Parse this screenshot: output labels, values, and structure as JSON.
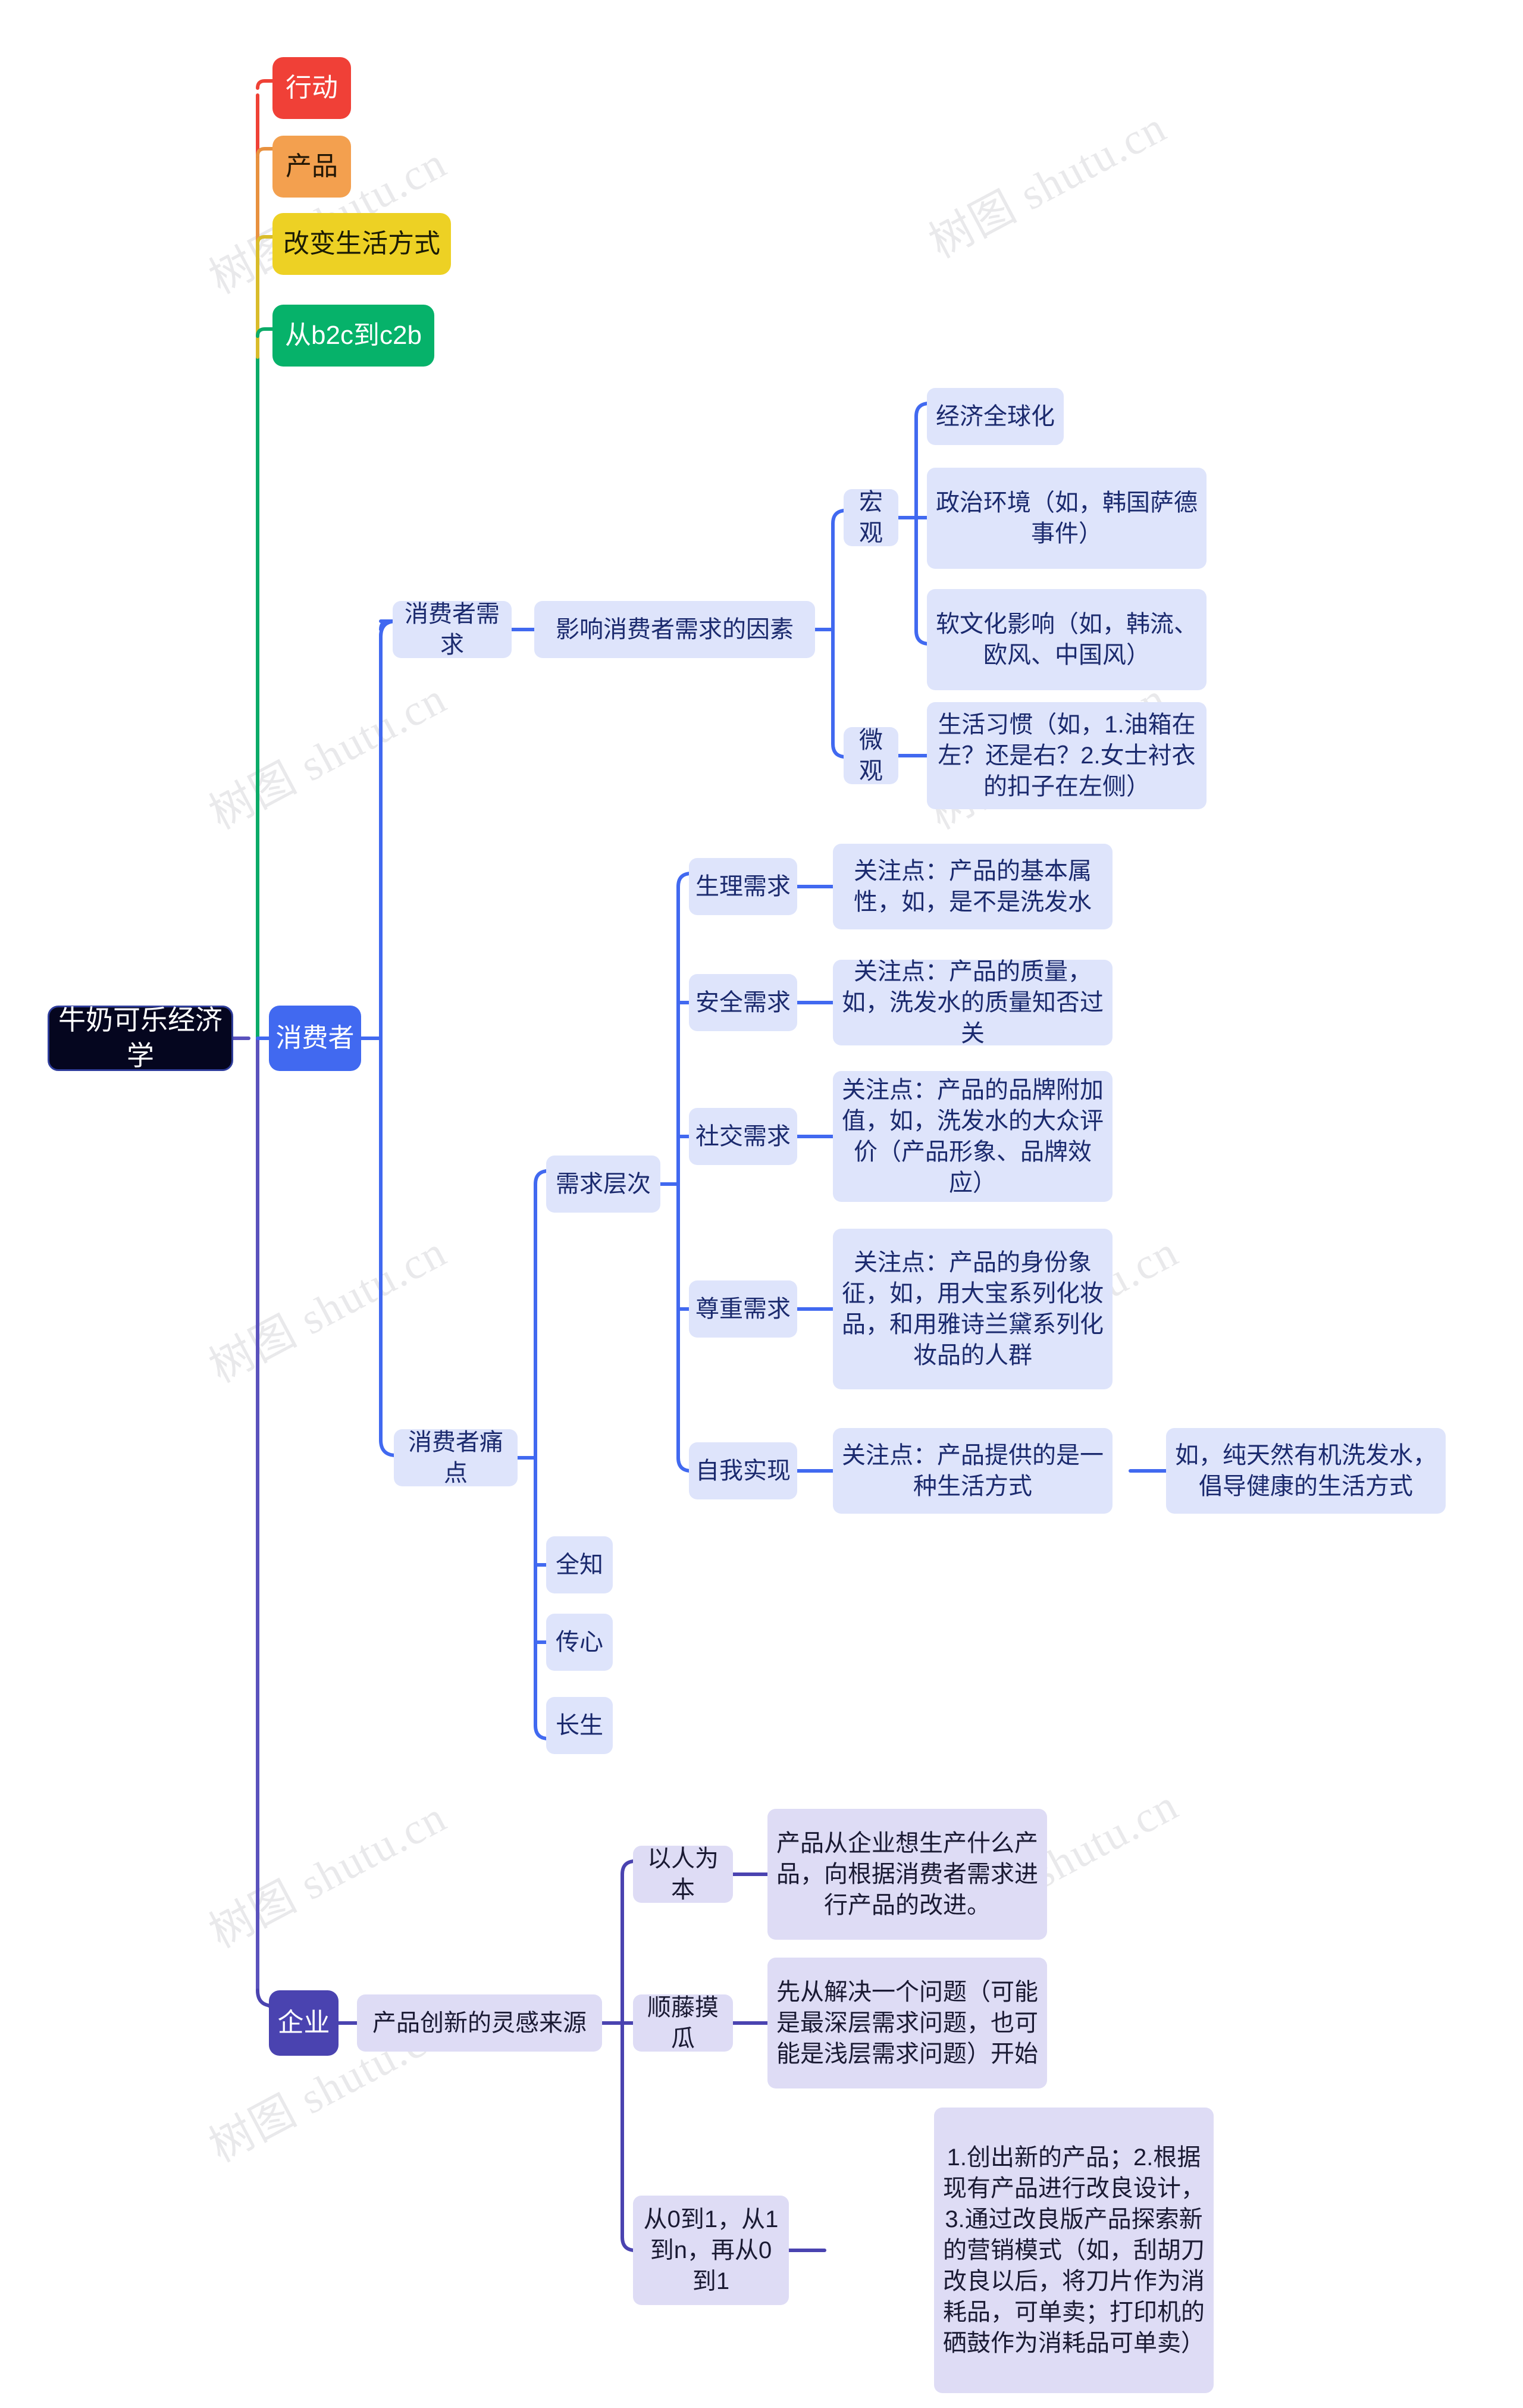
{
  "diagram": {
    "title": "牛奶可乐经济学",
    "type": "mindmap",
    "watermark_text": "树图 shutu.cn",
    "colors": {
      "root_bg": "#05061f",
      "root_border": "#2f3d9b",
      "consumer_bg": "#4169f0",
      "enterprise_bg": "#4a43b0",
      "red": "#f04037",
      "orange": "#f3a04f",
      "yellow": "#edd124",
      "green": "#06b26a",
      "node_bg": "#dee4fb",
      "node_bg_violet": "#dedcf5",
      "node_text": "#1b2a6e",
      "edge_blue": "#4169f0",
      "edge_purple": "#4a43b0"
    }
  },
  "nodes": {
    "root": "牛奶可乐经济学",
    "action": "行动",
    "product": "产品",
    "change_lifestyle": "改变生活方式",
    "b2c_to_c2b": "从b2c到c2b",
    "consumer": "消费者",
    "consumer_demand": "消费者需求",
    "demand_factors": "影响消费者需求的因素",
    "macro": "宏观",
    "macro_1": "经济全球化",
    "macro_2": "政治环境（如，韩国萨德事件）",
    "macro_3": "软文化影响（如，韩流、欧风、中国风）",
    "micro": "微观",
    "micro_1": "生活习惯（如，1.油箱在左？还是右？2.女士衬衣的扣子在左侧）",
    "consumer_painpoint": "消费者痛点",
    "demand_levels": "需求层次",
    "need_physio": "生理需求",
    "need_physio_detail": "关注点：产品的基本属性，如，是不是洗发水",
    "need_safety": "安全需求",
    "need_safety_detail": "关注点：产品的质量，如，洗发水的质量知否过关",
    "need_social": "社交需求",
    "need_social_detail": "关注点：产品的品牌附加值，如，洗发水的大众评价（产品形象、品牌效应）",
    "need_esteem": "尊重需求",
    "need_esteem_detail": "关注点：产品的身份象征，如，用大宝系列化妆品，和用雅诗兰黛系列化妆品的人群",
    "need_selfactual": "自我实现",
    "need_selfactual_detail": "关注点：产品提供的是一种生活方式",
    "need_selfactual_example": "如，纯天然有机洗发水，倡导健康的生活方式",
    "pain_omniscient": "全知",
    "pain_heart": "传心",
    "pain_longevity": "长生",
    "enterprise": "企业",
    "innovation_source": "产品创新的灵感来源",
    "people_first": "以人为本",
    "people_first_detail": "产品从企业想生产什么产品，向根据消费者需求进行产品的改进。",
    "follow_vine": "顺藤摸瓜",
    "follow_vine_detail": "先从解决一个问题（可能是最深层需求问题，也可能是浅层需求问题）开始",
    "zero_to_one": "从0到1，从1到n，再从0到1",
    "zero_to_one_detail": "1.创出新的产品；2.根据现有产品进行改良设计，3.通过改良版产品探索新的营销模式（如，刮胡刀改良以后，将刀片作为消耗品，可单卖；打印机的硒鼓作为消耗品可单卖）"
  }
}
